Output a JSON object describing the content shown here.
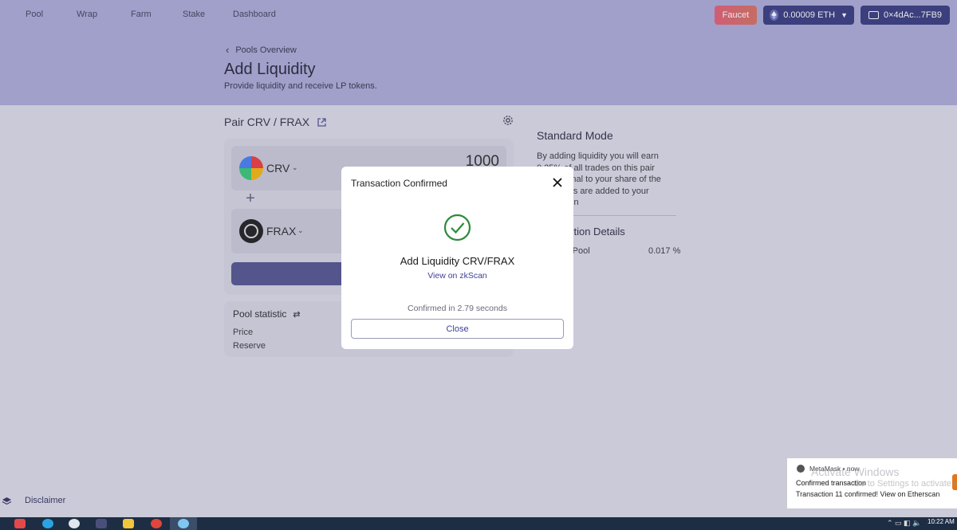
{
  "nav": {
    "items": [
      {
        "label": "Pool"
      },
      {
        "label": "Wrap"
      },
      {
        "label": "Farm"
      },
      {
        "label": "Stake"
      },
      {
        "label": "Dashboard"
      }
    ],
    "faucet_label": "Faucet",
    "eth_balance": "0.00009 ETH",
    "wallet_address": "0×4dAc...7FB9"
  },
  "header": {
    "back_label": "Pools Overview",
    "title": "Add Liquidity",
    "subtitle": "Provide liquidity and receive LP tokens."
  },
  "pair": {
    "label": "Pair CRV / FRAX",
    "token_a": {
      "symbol": "CRV",
      "amount": "1000"
    },
    "token_b": {
      "symbol": "FRAX"
    }
  },
  "pool_statistic": {
    "title": "Pool statistic",
    "price_label": "Price",
    "reserve_label": "Reserve"
  },
  "info": {
    "mode_title": "Standard Mode",
    "mode_text": "By adding liquidity you will earn 0.25% of all trades on this pair proportional to your share of the pool. Fees are added to your principal in",
    "tx_details_title": "Transaction Details",
    "share_label": "Share of Pool",
    "share_value": "0.017 %"
  },
  "footer": {
    "disclaimer_label": "Disclaimer"
  },
  "modal": {
    "title": "Transaction Confirmed",
    "headline": "Add Liquidity CRV/FRAX",
    "link": "View on zkScan",
    "confirmed_text": "Confirmed in 2.79 seconds",
    "close_label": "Close"
  },
  "toast": {
    "source": "MetaMask • now",
    "title": "Confirmed transaction",
    "body": "Transaction 11 confirmed! View on Etherscan",
    "watermark_title": "Activate Windows",
    "watermark_sub": "Go to Settings to activate Windows."
  },
  "taskbar": {
    "clock": "10:22 AM"
  },
  "colors": {
    "header_bg": "#a9a9d6",
    "accent": "#2f3278",
    "link": "#3d4296",
    "success": "#2e8b3a"
  }
}
